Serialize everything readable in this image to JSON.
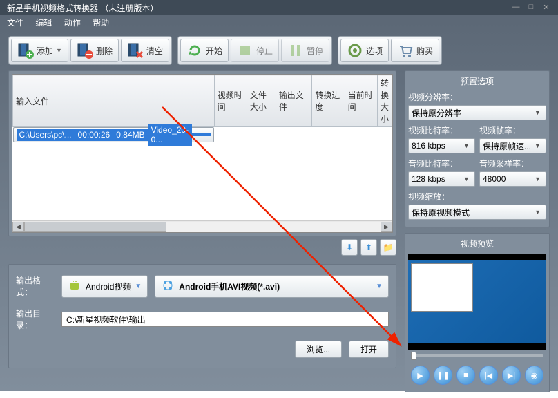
{
  "title": "新星手机视频格式转换器  （未注册版本）",
  "menu": {
    "file": "文件",
    "edit": "编辑",
    "action": "动作",
    "help": "帮助"
  },
  "toolbar": {
    "add": "添加",
    "delete": "删除",
    "clear": "清空",
    "start": "开始",
    "stop": "停止",
    "pause": "暂停",
    "options": "选项",
    "buy": "购买"
  },
  "table": {
    "headers": {
      "input": "输入文件",
      "vtime": "视频时间",
      "size": "文件大小",
      "output": "输出文件",
      "progress": "转换进度",
      "curtime": "当前时间",
      "csize": "转换大小"
    },
    "rows": [
      {
        "input": "C:\\Users\\pc\\...",
        "vtime": "00:00:26",
        "size": "0.84MB",
        "output": "Video_20-0...",
        "progress": "",
        "curtime": "",
        "csize": ""
      }
    ]
  },
  "output": {
    "format_lbl": "输出格式：",
    "format_cat": "Android视频",
    "format_val": "Android手机AVI视频(*.avi)",
    "dir_lbl": "输出目录：",
    "dir_val": "C:\\新星视频软件\\输出",
    "browse": "浏览...",
    "open": "打开"
  },
  "presets": {
    "title": "预置选项",
    "res_lbl": "视频分辨率：",
    "res_val": "保持原分辨率",
    "vbr_lbl": "视频比特率：",
    "vbr_val": "816 kbps",
    "fps_lbl": "视频帧率：",
    "fps_val": "保持原帧速...",
    "abr_lbl": "音频比特率：",
    "abr_val": "128 kbps",
    "sr_lbl": "音频采样率：",
    "sr_val": "48000",
    "scale_lbl": "视频缩放：",
    "scale_val": "保持原视频模式"
  },
  "preview": {
    "title": "视频预览"
  }
}
